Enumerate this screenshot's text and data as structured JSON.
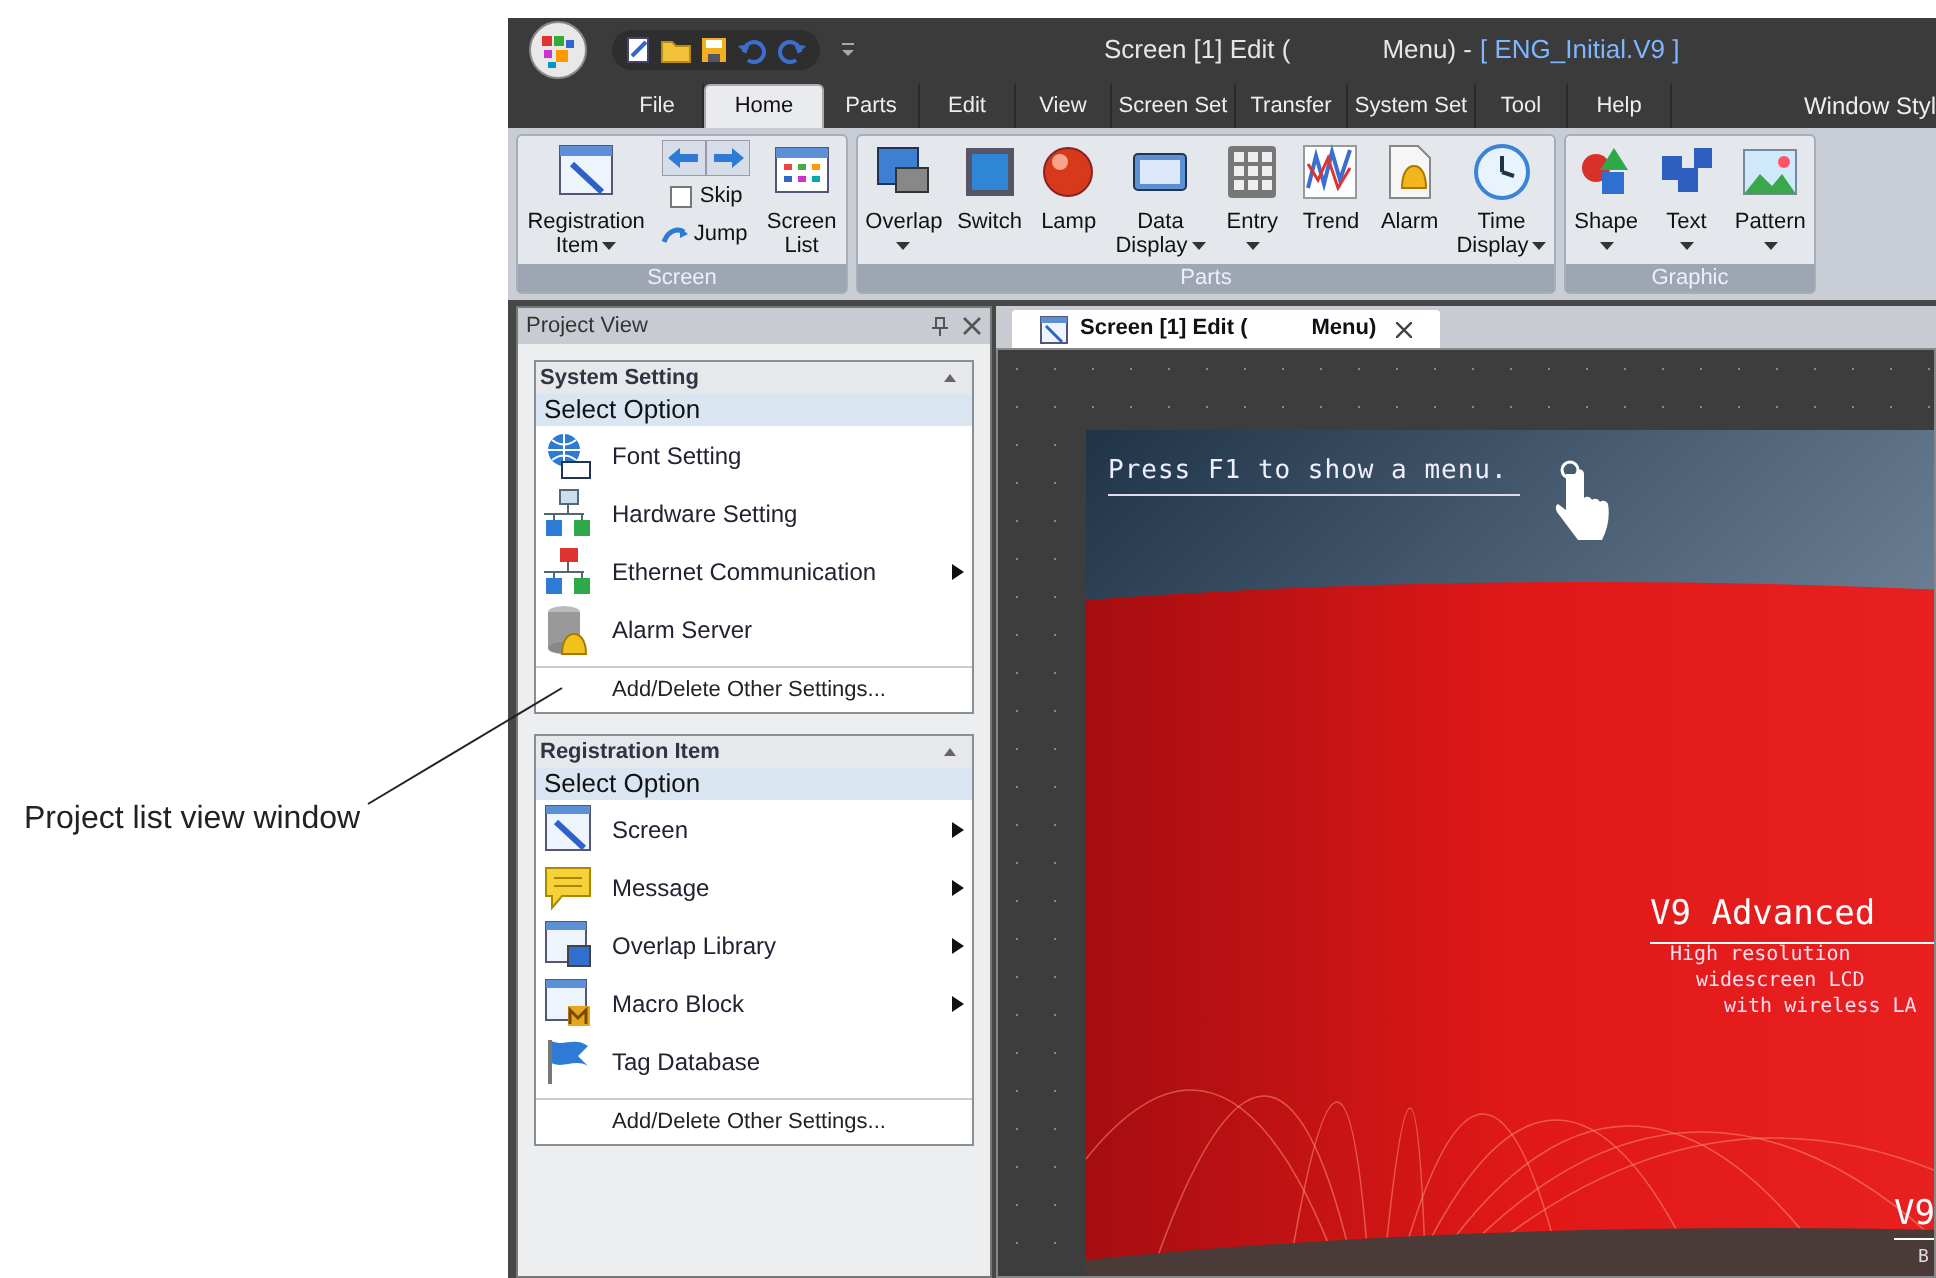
{
  "annotation": {
    "label": "Project list view window"
  },
  "window": {
    "title_parts": [
      "Screen [1] Edit (",
      "Menu) -",
      "[ ENG_Initial.V9 ]"
    ]
  },
  "menu_tabs": [
    {
      "label": "File",
      "selected": false
    },
    {
      "label": "Home",
      "selected": true
    },
    {
      "label": "Parts",
      "selected": false
    },
    {
      "label": "Edit",
      "selected": false
    },
    {
      "label": "View",
      "selected": false
    },
    {
      "label": "Screen Set",
      "selected": false
    },
    {
      "label": "Transfer",
      "selected": false
    },
    {
      "label": "System Set",
      "selected": false
    },
    {
      "label": "Tool",
      "selected": false
    },
    {
      "label": "Help",
      "selected": false
    }
  ],
  "window_style": "Window Styl",
  "ribbon": {
    "groups": [
      {
        "name": "Screen",
        "items": [
          {
            "kind": "large",
            "lines": [
              "Registration",
              "Item"
            ],
            "dropdown": true
          },
          {
            "kind": "nav",
            "skip": {
              "label": "Skip",
              "checked": false
            },
            "jump": "Jump"
          },
          {
            "kind": "large",
            "lines": [
              "Screen",
              "List"
            ],
            "dropdown": false
          }
        ]
      },
      {
        "name": "Parts",
        "items": [
          {
            "kind": "large",
            "lines": [
              "Overlap"
            ],
            "dropdown": true
          },
          {
            "kind": "large",
            "lines": [
              "Switch"
            ],
            "dropdown": false
          },
          {
            "kind": "large",
            "lines": [
              "Lamp"
            ],
            "dropdown": false
          },
          {
            "kind": "large",
            "lines": [
              "Data",
              "Display"
            ],
            "dropdown": true
          },
          {
            "kind": "large",
            "lines": [
              "Entry"
            ],
            "dropdown": true
          },
          {
            "kind": "large",
            "lines": [
              "Trend"
            ],
            "dropdown": false
          },
          {
            "kind": "large",
            "lines": [
              "Alarm"
            ],
            "dropdown": false
          },
          {
            "kind": "large",
            "lines": [
              "Time",
              "Display"
            ],
            "dropdown": true
          }
        ]
      },
      {
        "name": "Graphic",
        "items": [
          {
            "kind": "large",
            "lines": [
              "Shape"
            ],
            "dropdown": true
          },
          {
            "kind": "large",
            "lines": [
              "Text"
            ],
            "dropdown": true
          },
          {
            "kind": "large",
            "lines": [
              "Pattern"
            ],
            "dropdown": true
          }
        ]
      }
    ]
  },
  "project_view": {
    "title": "Project View",
    "sections": [
      {
        "title": "System Setting",
        "header": "Select Option",
        "items": [
          {
            "label": "Font Setting",
            "submenu": false
          },
          {
            "label": "Hardware Setting",
            "submenu": false
          },
          {
            "label": "Ethernet Communication",
            "submenu": true
          },
          {
            "label": "Alarm Server",
            "submenu": false
          }
        ],
        "footer": "Add/Delete Other Settings..."
      },
      {
        "title": "Registration Item",
        "header": "Select Option",
        "items": [
          {
            "label": "Screen",
            "submenu": true
          },
          {
            "label": "Message",
            "submenu": true
          },
          {
            "label": "Overlap Library",
            "submenu": true
          },
          {
            "label": "Macro Block",
            "submenu": true
          },
          {
            "label": "Tag Database",
            "submenu": false
          }
        ],
        "footer": "Add/Delete Other Settings..."
      }
    ]
  },
  "editor": {
    "tab": {
      "title_parts": [
        "Screen [1] Edit (",
        "Menu)"
      ]
    },
    "screen": {
      "hint": "Press F1 to show a menu.",
      "headline": "V9 Advanced",
      "lines": [
        "High resolution",
        "widescreen LCD",
        "with wireless LA"
      ],
      "corner_title": "V9",
      "corner_sub": "B"
    }
  }
}
